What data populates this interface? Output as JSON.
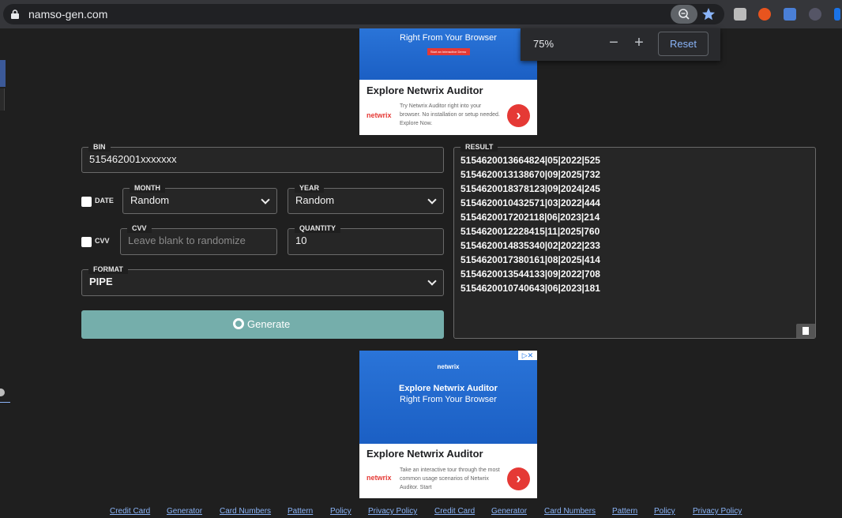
{
  "browser": {
    "url": "namso-gen.com",
    "icons": [
      "lock-icon",
      "zoom-icon",
      "star-icon",
      "lightbulb-ext-icon",
      "fire-ext-icon",
      "translate-ext-icon",
      "spy-ext-icon",
      "cast-icon"
    ],
    "accent": "#8ab4f8"
  },
  "zoom_popup": {
    "percent": "75%",
    "minus": "−",
    "plus": "+",
    "reset": "Reset"
  },
  "ad_top": {
    "headline2": "Right From Your Browser",
    "button": "Start an Interactive Demo",
    "title": "Explore Netwrix Auditor",
    "logo": "netwrix",
    "body": "Try Netwrix Auditor right into your browser. No installation or setup needed. Explore Now.",
    "cta": "›"
  },
  "ad_bottom": {
    "brand": "netwrix",
    "headline1": "Explore Netwrix Auditor",
    "headline2": "Right From Your Browser",
    "title": "Explore Netwrix Auditor",
    "logo": "netwrix",
    "body": "Take an interactive tour through the most common usage scenarios of Netwrix Auditor. Start",
    "cta": "›",
    "choices": "▷✕"
  },
  "form": {
    "bin": {
      "label": "BIN",
      "value": "515462001xxxxxxx"
    },
    "date": {
      "label": "DATE",
      "checked": false
    },
    "month": {
      "label": "MONTH",
      "value": "Random"
    },
    "year": {
      "label": "YEAR",
      "value": "Random"
    },
    "cvv_check": {
      "label": "CVV",
      "checked": false
    },
    "cvv": {
      "label": "CVV",
      "placeholder": "Leave blank to randomize"
    },
    "quantity": {
      "label": "QUANTITY",
      "value": "10"
    },
    "format": {
      "label": "FORMAT",
      "value": "PIPE"
    },
    "generate": "Generate",
    "button_color": "#75aeab"
  },
  "result": {
    "label": "RESULT",
    "lines": [
      "5154620013664824|05|2022|525",
      "5154620013138670|09|2025|732",
      "5154620018378123|09|2024|245",
      "5154620010432571|03|2022|444",
      "5154620017202118|06|2023|214",
      "5154620012228415|11|2025|760",
      "5154620014835340|02|2022|233",
      "5154620017380161|08|2025|414",
      "5154620013544133|09|2022|708",
      "5154620010740643|06|2023|181"
    ]
  },
  "footer": {
    "links": [
      "Credit Card",
      "Generator",
      "Card Numbers",
      "Pattern",
      "Policy",
      "Privacy Policy",
      "Credit Card",
      "Generator",
      "Card Numbers",
      "Pattern",
      "Policy",
      "Privacy Policy"
    ]
  }
}
